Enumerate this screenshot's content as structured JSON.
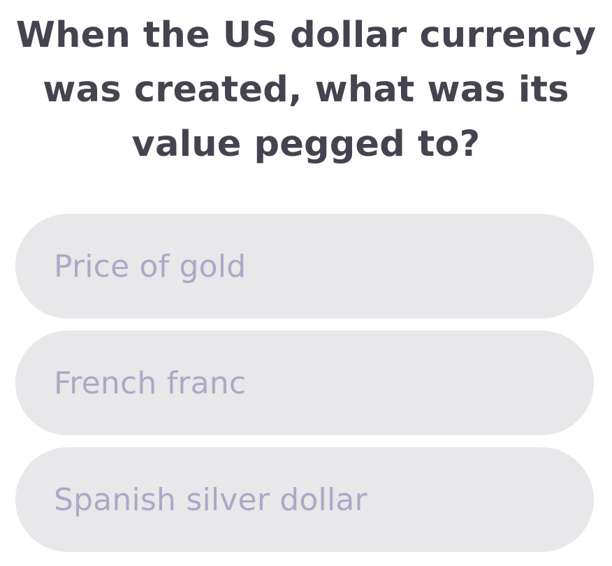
{
  "question": {
    "lines": [
      "When the US dollar currency",
      "was created, what was its",
      "value pegged to?"
    ]
  },
  "options": [
    {
      "label": "Price of gold"
    },
    {
      "label": "French franc"
    },
    {
      "label": "Spanish silver dollar"
    }
  ],
  "colors": {
    "question_text": "#45434f",
    "option_background": "#e8e7e9",
    "option_text": "#aca8c6"
  }
}
